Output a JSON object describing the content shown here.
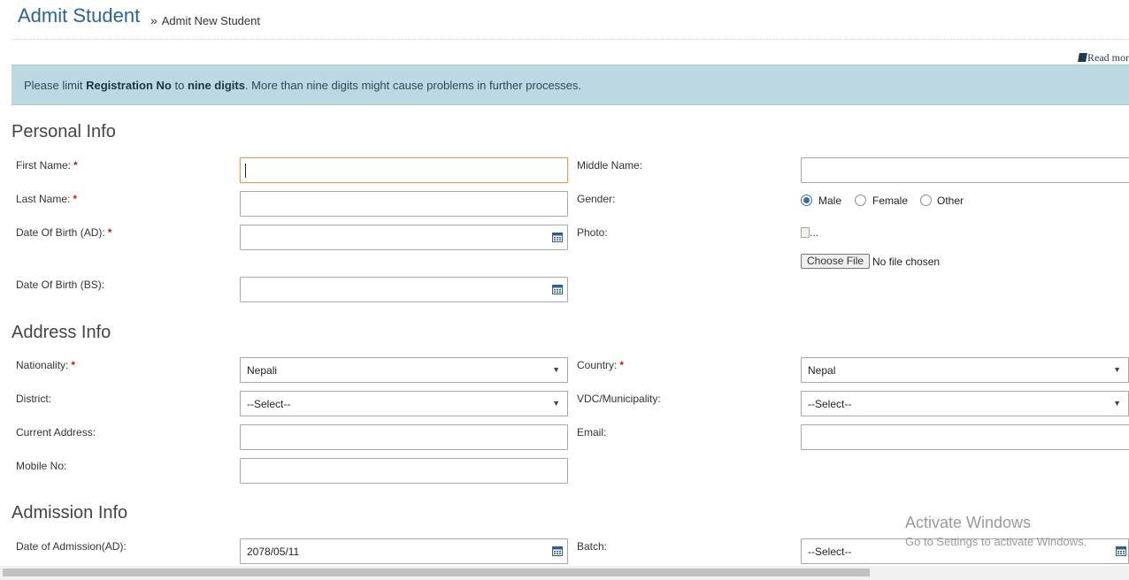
{
  "header": {
    "title": "Admit Student",
    "breadcrumb_sep": "»",
    "breadcrumb": "Admit New Student",
    "read_more": "Read mor"
  },
  "alert": {
    "text_1": "Please limit ",
    "bold_1": "Registration No",
    "text_2": " to ",
    "bold_2": "nine digits",
    "text_3": ". More than nine digits might cause problems in further processes."
  },
  "personal": {
    "heading": "Personal Info",
    "first_name_label": "First Name:",
    "middle_name_label": "Middle Name:",
    "last_name_label": "Last Name:",
    "gender_label": "Gender:",
    "gender_options": [
      "Male",
      "Female",
      "Other"
    ],
    "gender_selected": "Male",
    "dob_ad_label": "Date Of Birth (AD):",
    "photo_label": "Photo:",
    "photo_alt": "...",
    "choose_file": "Choose File",
    "no_file": "No file chosen",
    "dob_bs_label": "Date Of Birth (BS):"
  },
  "address": {
    "heading": "Address Info",
    "nationality_label": "Nationality:",
    "nationality_value": "Nepali",
    "country_label": "Country:",
    "country_value": "Nepal",
    "district_label": "District:",
    "district_value": "--Select--",
    "vdc_label": "VDC/Municipality:",
    "vdc_value": "--Select--",
    "current_address_label": "Current Address:",
    "email_label": "Email:",
    "mobile_label": "Mobile No:"
  },
  "admission": {
    "heading": "Admission Info",
    "doa_label": "Date of Admission(AD):",
    "doa_value": "2078/05/11",
    "batch_label": "Batch:",
    "batch_value": "--Select--"
  },
  "required_mark": "*",
  "dropdown_arrow": "▼",
  "watermark": {
    "line1": "Activate Windows",
    "line2": "Go to Settings to activate Windows."
  },
  "colors": {
    "title": "#2a6496",
    "alert_bg": "#bcd9e2",
    "required": "#b22222",
    "radio_checked": "#3b6ea0"
  }
}
